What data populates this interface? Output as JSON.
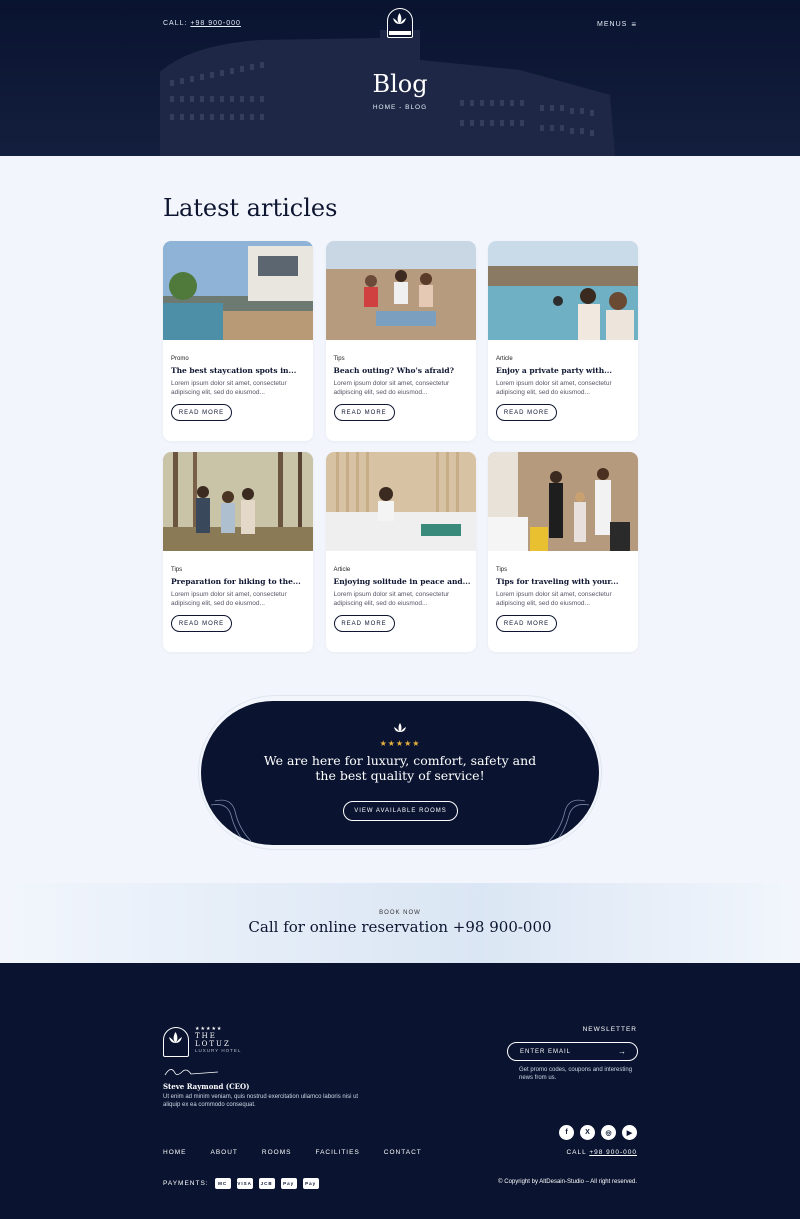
{
  "header": {
    "call_label": "CALL:",
    "call_number": "+98 900-000",
    "logo_text": "THE LOTUZ",
    "menus_label": "MENUS",
    "title": "Blog",
    "breadcrumb": "HOME - BLOG"
  },
  "main": {
    "section_title": "Latest articles",
    "articles": [
      {
        "category": "Promo",
        "title": "The best staycation spots in...",
        "excerpt": "Lorem ipsum dolor sit amet, consectetur adipiscing elit, sed do eiusmod...",
        "button": "READ MORE",
        "image": "pool-villa"
      },
      {
        "category": "Tips",
        "title": "Beach outing? Who's afraid?",
        "excerpt": "Lorem ipsum dolor sit amet, consectetur adipiscing elit, sed do eiusmod...",
        "button": "READ MORE",
        "image": "beach-friends"
      },
      {
        "category": "Article",
        "title": "Enjoy a private party with...",
        "excerpt": "Lorem ipsum dolor sit amet, consectetur adipiscing elit, sed do eiusmod...",
        "button": "READ MORE",
        "image": "pool-party"
      },
      {
        "category": "Tips",
        "title": "Preparation for hiking to the...",
        "excerpt": "Lorem ipsum dolor sit amet, consectetur adipiscing elit, sed do eiusmod...",
        "button": "READ MORE",
        "image": "forest-hike"
      },
      {
        "category": "Article",
        "title": "Enjoying solitude in peace and...",
        "excerpt": "Lorem ipsum dolor sit amet, consectetur adipiscing elit, sed do eiusmod...",
        "button": "READ MORE",
        "image": "bedroom-relax"
      },
      {
        "category": "Tips",
        "title": "Tips for traveling with your...",
        "excerpt": "Lorem ipsum dolor sit amet, consectetur adipiscing elit, sed do eiusmod...",
        "button": "READ MORE",
        "image": "family-luggage"
      }
    ]
  },
  "promo": {
    "stars": "★★★★★",
    "message_line1": "We are here for luxury, comfort, safety and",
    "message_line2": "the best quality of service!",
    "button": "VIEW AVAILABLE ROOMS"
  },
  "booking": {
    "label": "BOOK NOW",
    "text": "Call for online reservation +98 900-000"
  },
  "footer": {
    "brand_stars": "★★★★★",
    "brand_line1": "THE",
    "brand_line2": "LOTUZ",
    "brand_sub": "LUXURY HOTEL",
    "ceo_name": "Steve Raymond (CEO)",
    "ceo_text": "Ut enim ad minim veniam, quis nostrud exercitation ullamco laboris nisi ut aliquip ex ea commodo consequat.",
    "newsletter_label": "NEWSLETTER",
    "email_placeholder": "ENTER EMAIL",
    "promo_text": "Get promo codes, coupons and interesting news from us.",
    "social": [
      "f",
      "X",
      "◎",
      "▶"
    ],
    "nav": [
      "HOME",
      "ABOUT",
      "ROOMS",
      "FACILITIES",
      "CONTACT"
    ],
    "call_label": "CALL",
    "call_number": "+98 900-000",
    "payments_label": "PAYMENTS:",
    "payment_cards": [
      "MC",
      "VISA",
      "JCB",
      "Pay",
      "Pay"
    ],
    "copyright": "© Copyright by AltDesain-Studio – All right reserved."
  },
  "colors": {
    "navy": "#0a1430",
    "background": "#f2f6fc",
    "star": "#e8b13c"
  }
}
